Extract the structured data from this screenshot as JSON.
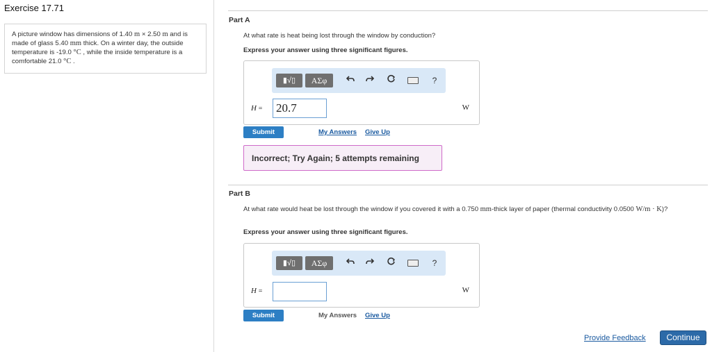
{
  "exercise": {
    "title": "Exercise 17.71",
    "problem_parts": [
      "A picture window has dimensions of 1.40 ",
      "m",
      " × 2.50 ",
      "m",
      " and is made of glass 5.40 ",
      "mm",
      " thick. On a winter day, the outside temperature is -19.0 ",
      "°C",
      " , while the inside temperature is a comfortable 21.0 ",
      "°C",
      " ."
    ]
  },
  "part_a": {
    "title": "Part A",
    "question": "At what rate is heat being lost through the window by conduction?",
    "instruction": "Express your answer using three significant figures.",
    "variable": "H",
    "equals": "=",
    "answer_value": "20.7",
    "unit": "W",
    "submit_label": "Submit",
    "my_answers_label": "My Answers",
    "give_up_label": "Give Up",
    "feedback": "Incorrect; Try Again; 5 attempts remaining"
  },
  "part_b": {
    "title": "Part B",
    "question_parts": [
      "At what rate would heat be lost through the window if you covered it with a 0.750 ",
      "mm",
      "-thick layer of paper (thermal conductivity 0.0500 ",
      "W/m · K",
      ")?"
    ],
    "instruction": "Express your answer using three significant figures.",
    "variable": "H",
    "equals": "=",
    "answer_value": "",
    "unit": "W",
    "submit_label": "Submit",
    "my_answers_label": "My Answers",
    "give_up_label": "Give Up"
  },
  "toolbar": {
    "frac_label": "▮√▯",
    "greek_label": "ΑΣφ",
    "help_label": "?"
  },
  "footer": {
    "provide_feedback_label": "Provide Feedback",
    "continue_label": "Continue"
  },
  "colors": {
    "accent": "#2d7fc4",
    "toolbar_bg": "#d9e8f7",
    "feedback_border": "#cf6ac9",
    "feedback_bg": "#f7eef7"
  }
}
